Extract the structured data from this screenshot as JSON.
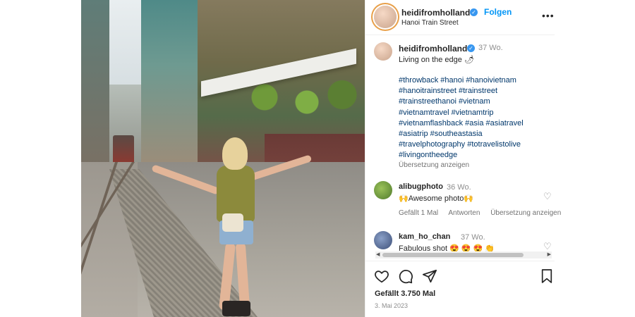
{
  "post": {
    "username": "heidifromholland",
    "follow_label": "Folgen",
    "location": "Hanoi Train Street",
    "more_icon": "more-icon",
    "verified_icon": "verified-badge-icon"
  },
  "caption": {
    "username": "heidifromholland",
    "time": "37 Wo.",
    "text": "Living on the edge 🌶",
    "hashtags": [
      "#throwback #hanoi #hanoivietnam",
      "#hanoitrainstreet #trainstreet",
      "#trainstreethanoi #vietnam",
      "#vietnamtravel #vietnamtrip",
      "#vietnamflashback #asia #asiatravel",
      "#asiatrip #southeastasia",
      "#travelphotography #totravelistolive",
      "#livingontheedge"
    ],
    "translate_label": "Übersetzung anzeigen"
  },
  "comments": [
    {
      "username": "alibugphoto",
      "time": "36 Wo.",
      "text": "🙌Awesome photo🙌",
      "likes": "Gefällt 1 Mal",
      "reply": "Antworten",
      "translate": "Übersetzung anzeigen"
    },
    {
      "username": "kam_ho_chan",
      "time": "37 Wo.",
      "text": "Fabulous shot 😍 😍 😍 👏"
    }
  ],
  "actions": {
    "heart_icon": "heart-icon",
    "comment_icon": "comment-icon",
    "share_icon": "share-icon",
    "save_icon": "bookmark-icon"
  },
  "stats": {
    "likes": "Gefällt 3.750 Mal",
    "date": "3. Mai 2023"
  },
  "colors": {
    "accent": "#0095f6",
    "verified": "#3897f0",
    "hashtag": "#00376b"
  }
}
